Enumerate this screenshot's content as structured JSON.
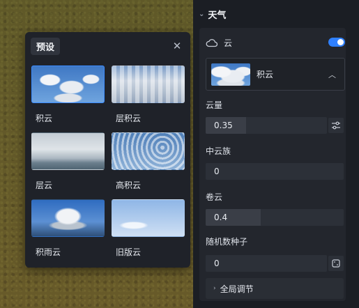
{
  "preset_panel": {
    "title": "预设",
    "close_icon": "close-icon",
    "items": [
      {
        "label": "积云",
        "selected": true
      },
      {
        "label": "层积云",
        "selected": false
      },
      {
        "label": "层云",
        "selected": false
      },
      {
        "label": "高积云",
        "selected": false
      },
      {
        "label": "积雨云",
        "selected": false
      },
      {
        "label": "旧版云",
        "selected": false
      }
    ]
  },
  "weather_panel": {
    "section_title": "天气",
    "cloud": {
      "label": "云",
      "enabled": true,
      "selected_preset": "积云"
    },
    "fields": {
      "cloud_amount": {
        "label": "云量",
        "value": "0.35"
      },
      "mid_cloud": {
        "label": "中云族",
        "value": "0"
      },
      "cirrus": {
        "label": "卷云",
        "value": "0.4"
      },
      "seed": {
        "label": "随机数种子",
        "value": "0"
      }
    },
    "global_adjust": {
      "label": "全局调节"
    }
  },
  "colors": {
    "accent": "#2f80ff",
    "panel": "#1b1e24",
    "card": "#23262d"
  }
}
